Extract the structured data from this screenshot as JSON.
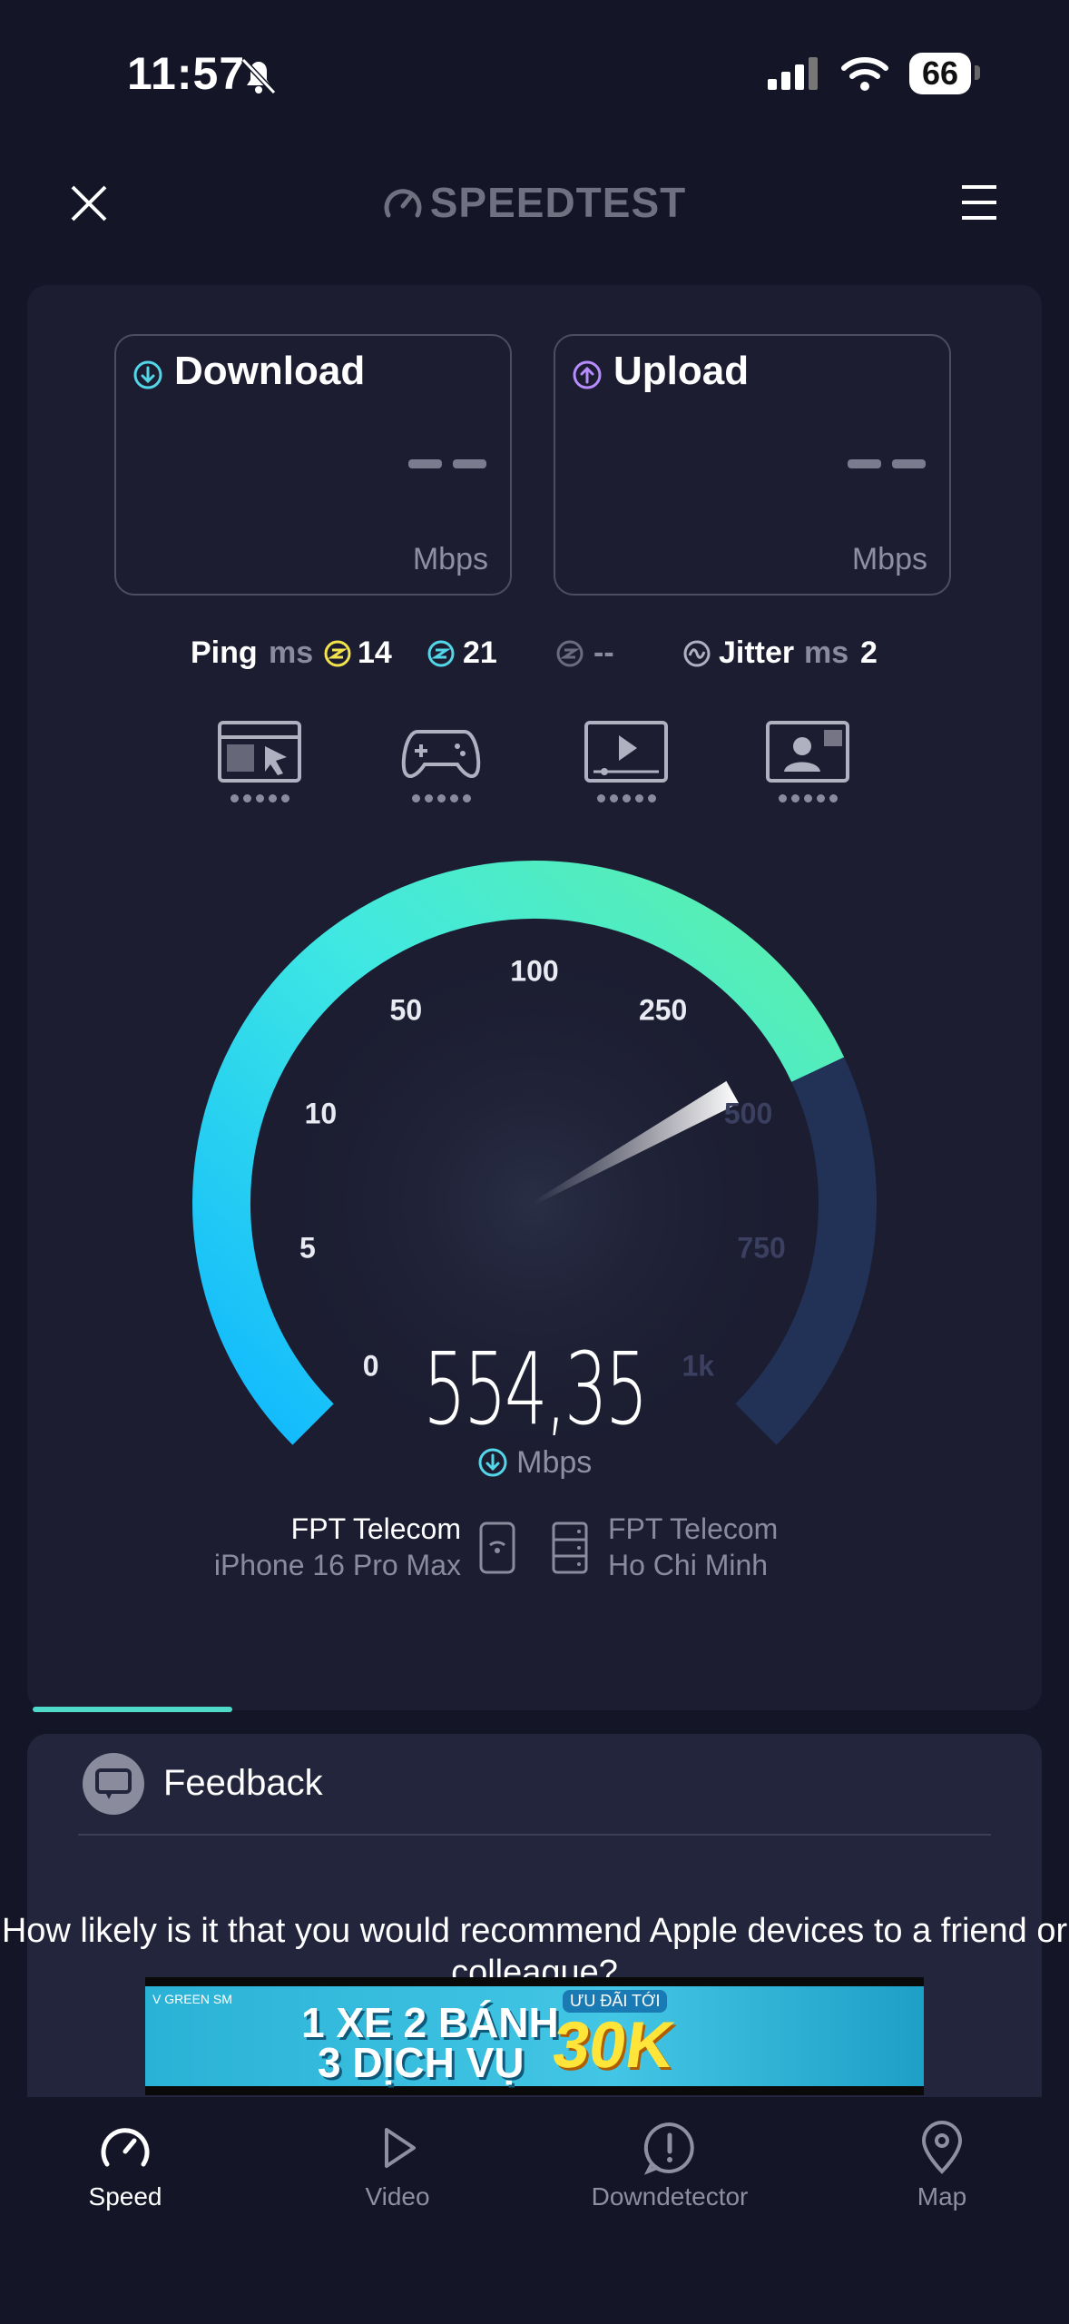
{
  "status_bar": {
    "time": "11:57",
    "battery": "66",
    "icons": [
      "bell-slash-icon",
      "signal-icon",
      "wifi-icon",
      "battery-icon"
    ]
  },
  "header": {
    "title": "SPEEDTEST",
    "close_icon": "close-icon",
    "menu_icon": "menu-icon"
  },
  "metrics": {
    "download": {
      "label": "Download",
      "value": "– –",
      "unit": "Mbps",
      "accent": "#52d6e8"
    },
    "upload": {
      "label": "Upload",
      "value": "– –",
      "unit": "Mbps",
      "accent": "#b78cff"
    }
  },
  "ping": {
    "label": "Ping",
    "unit": "ms",
    "idle": "14",
    "download": "21",
    "upload": "--",
    "jitter_label": "Jitter",
    "jitter_unit": "ms",
    "jitter_value": "2"
  },
  "activities": [
    "browsing-icon",
    "gaming-icon",
    "video-streaming-icon",
    "video-call-icon"
  ],
  "gauge": {
    "labels": [
      "0",
      "5",
      "10",
      "50",
      "100",
      "250",
      "500",
      "750",
      "1k"
    ],
    "value": "554,35",
    "unit": "Mbps",
    "fraction": 0.74
  },
  "server": {
    "provider_left": "FPT Telecom",
    "device": "iPhone 16 Pro Max",
    "provider_right": "FPT Telecom",
    "location": "Ho Chi Minh"
  },
  "feedback": {
    "title": "Feedback",
    "question": "How likely is it that you would recommend Apple devices to a friend or colleague?"
  },
  "ad": {
    "line1": "1 XE 2 BÁNH",
    "line2": "3 DỊCH VỤ",
    "price": "30K",
    "tag": "ƯU ĐÃI TỚI",
    "brand": "V GREEN SM"
  },
  "nav": [
    {
      "label": "Speed",
      "icon": "speedometer-icon",
      "active": true
    },
    {
      "label": "Video",
      "icon": "play-icon",
      "active": false
    },
    {
      "label": "Downdetector",
      "icon": "alert-icon",
      "active": false
    },
    {
      "label": "Map",
      "icon": "map-pin-icon",
      "active": false
    }
  ],
  "colors": {
    "background": "#141526",
    "card": "#1c1d31",
    "gauge_start": "#10b8ff",
    "gauge_end": "#5ef0a8"
  }
}
